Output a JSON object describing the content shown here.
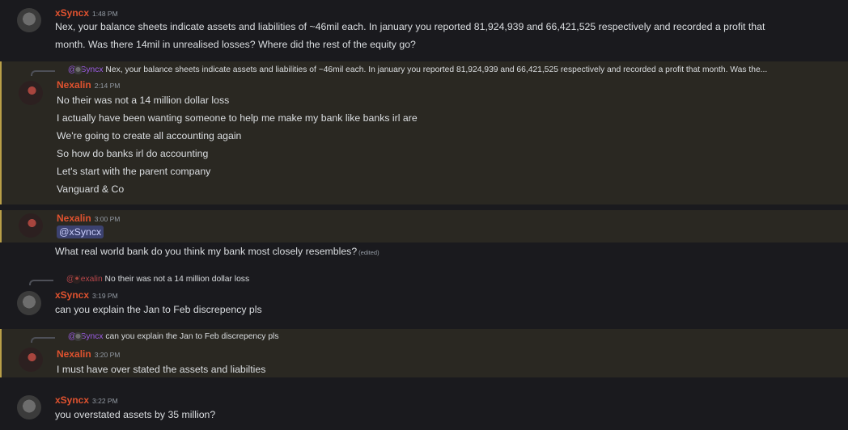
{
  "messages": [
    {
      "username": "xSyncx",
      "time": "1:48 PM",
      "lines": [
        "Nex, your balance sheets indicate assets and liabilities of ~46mil each. In january you reported 81,924,939 and 66,421,525 respectively and recorded a profit that",
        "month. Was there 14mil in unrealised losses? Where did the rest of the equity go?"
      ]
    },
    {
      "reply": {
        "name": "@xSyncx",
        "text": "Nex, your balance sheets indicate assets and liabilities of ~46mil each. In january you reported 81,924,939 and 66,421,525 respectively and recorded a profit that month. Was the..."
      },
      "username": "Nexalin",
      "time": "2:14 PM",
      "lines": [
        "No their was not a 14 million dollar loss",
        "I actually have been wanting someone to help me make my bank like banks irl are",
        "We're going to create all accounting again",
        "So how do banks irl do accounting",
        "Let's start with the parent company",
        "Vanguard & Co"
      ]
    },
    {
      "username": "Nexalin",
      "time": "3:00 PM",
      "mention": "@xSyncx",
      "line": "What real world bank do you think my bank most closely resembles?",
      "edited": "(edited)"
    },
    {
      "reply": {
        "name": "@Nexalin",
        "text": "No their was not a 14 million dollar loss"
      },
      "username": "xSyncx",
      "time": "3:19 PM",
      "lines": [
        "can you explain the Jan to Feb discrepency pls"
      ]
    },
    {
      "reply": {
        "name": "@xSyncx",
        "text": "can you explain the Jan to Feb discrepency pls"
      },
      "username": "Nexalin",
      "time": "3:20 PM",
      "lines": [
        "I must have over stated the assets and liabilties"
      ]
    },
    {
      "username": "xSyncx",
      "time": "3:22 PM",
      "lines": [
        "you overstated assets by 35 million?"
      ]
    }
  ]
}
